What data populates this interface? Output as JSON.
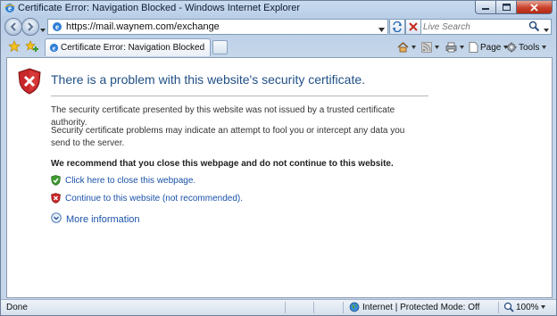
{
  "window": {
    "title": "Certificate Error: Navigation Blocked - Windows Internet Explorer"
  },
  "address_bar": {
    "url": "https://mail.waynem.com/exchange"
  },
  "search": {
    "placeholder": "Live Search"
  },
  "tabs": [
    {
      "label": "Certificate Error: Navigation Blocked"
    }
  ],
  "command_bar": {
    "page_label": "Page",
    "tools_label": "Tools"
  },
  "content": {
    "heading": "There is a problem with this website's security certificate.",
    "para1": "The security certificate presented by this website was not issued by a trusted certificate authority.",
    "para2": "Security certificate problems may indicate an attempt to fool you or intercept any data you send to the server.",
    "recommendation": "We recommend that you close this webpage and do not continue to this website.",
    "close_link": "Click here to close this webpage.",
    "continue_link": "Continue to this website (not recommended).",
    "more_info": "More information"
  },
  "status_bar": {
    "status": "Done",
    "zone": "Internet | Protected Mode: Off",
    "zoom": "100%"
  },
  "colors": {
    "heading": "#1f4f85",
    "link": "#1a52a8",
    "shield_red": "#c8282a",
    "shield_green": "#3c9a2e"
  }
}
